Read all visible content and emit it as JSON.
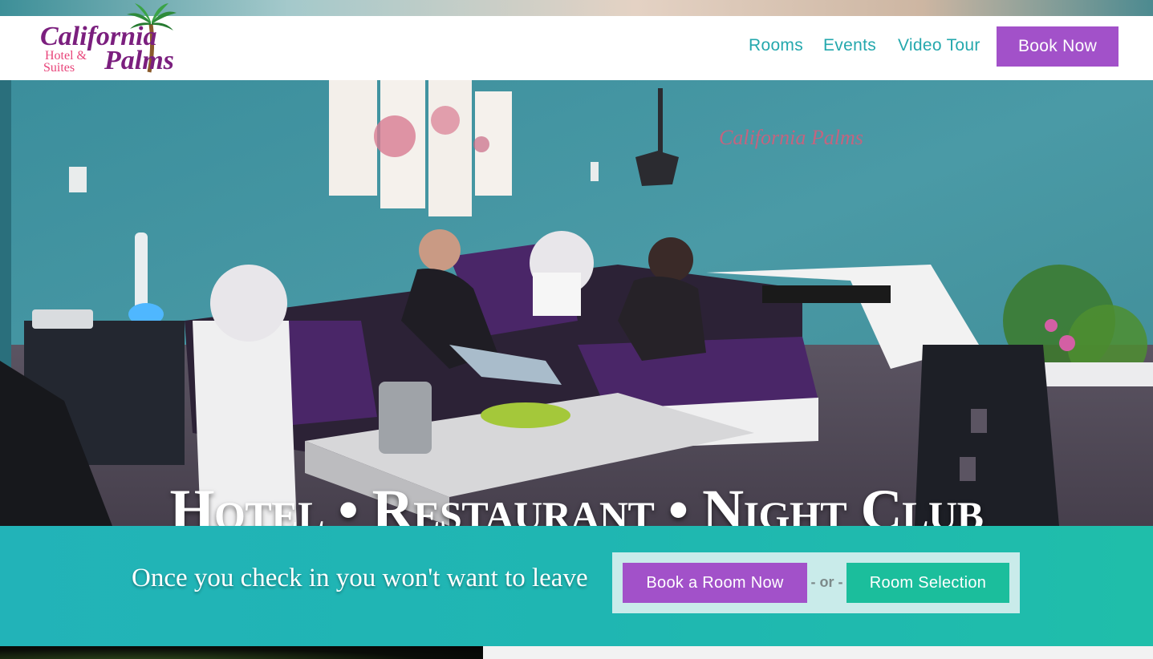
{
  "header": {
    "logo": {
      "line1": "California",
      "line2": "Palms",
      "sub1": "Hotel &",
      "sub2": "Suites"
    },
    "nav": [
      {
        "label": "Rooms"
      },
      {
        "label": "Events"
      },
      {
        "label": "Video Tour"
      }
    ],
    "book_now": "Book Now"
  },
  "hero": {
    "headline": "Hotel • Restaurant • Night Club"
  },
  "band": {
    "tagline": "Once you check in you won't want to leave",
    "book_room": "Book a Room Now",
    "or": "- or -",
    "room_selection": "Room Selection"
  },
  "colors": {
    "teal_text": "#24a8ad",
    "purple_button": "#a251c9",
    "green_button": "#1bbe9c",
    "band_teal": "#1fb6b2",
    "logo_purple": "#7b1f7e",
    "logo_pink": "#e8447a"
  }
}
